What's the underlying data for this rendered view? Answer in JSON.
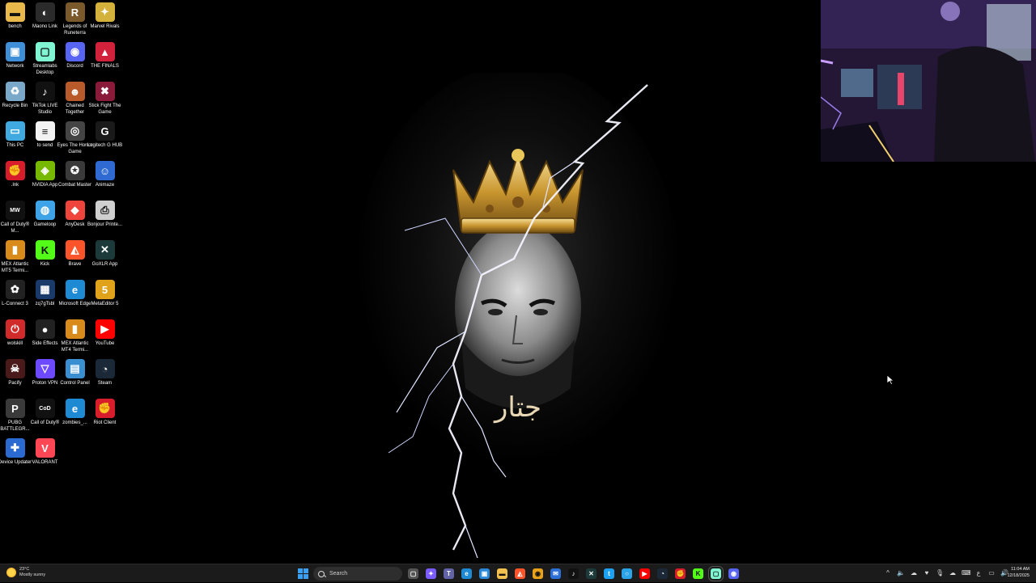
{
  "desktop_icons": [
    {
      "label": "bench",
      "color": "#e8b84a",
      "glyph": "▬"
    },
    {
      "label": "Maono Link",
      "color": "#2b2b2b",
      "glyph": "◐"
    },
    {
      "label": "Legends of Runeterra",
      "color": "#7a5a2a",
      "glyph": "R"
    },
    {
      "label": "Marvel Rivals",
      "color": "#d4b13a",
      "glyph": "✦"
    },
    {
      "label": "Network",
      "color": "#3f8fd8",
      "glyph": "▣"
    },
    {
      "label": "Streamlabs Desktop",
      "color": "#80f5d2",
      "glyph": "▢"
    },
    {
      "label": "Discord",
      "color": "#5865f2",
      "glyph": "◉"
    },
    {
      "label": "THE FINALS",
      "color": "#d2213b",
      "glyph": "▲"
    },
    {
      "label": "Recycle Bin",
      "color": "#7aa8c8",
      "glyph": "♻"
    },
    {
      "label": "TikTok LIVE Studio",
      "color": "#111111",
      "glyph": "♪"
    },
    {
      "label": "Chained Together",
      "color": "#b85a2a",
      "glyph": "☻"
    },
    {
      "label": "Stick Fight The Game",
      "color": "#8a1a3a",
      "glyph": "✖"
    },
    {
      "label": "This PC",
      "color": "#3fa9e0",
      "glyph": "▭"
    },
    {
      "label": "to send",
      "color": "#f2f2f2",
      "glyph": "≡"
    },
    {
      "label": "Eyes The Horror Game",
      "color": "#444444",
      "glyph": "◎"
    },
    {
      "label": "Logitech G HUB",
      "color": "#1a1a1a",
      "glyph": "G"
    },
    {
      "label": ".lnk",
      "color": "#d71d2b",
      "glyph": "✊"
    },
    {
      "label": "NVIDIA App",
      "color": "#76b900",
      "glyph": "◈"
    },
    {
      "label": "Combat Master",
      "color": "#3a3a3a",
      "glyph": "✪"
    },
    {
      "label": "Animaze",
      "color": "#2e6ad1",
      "glyph": "☺"
    },
    {
      "label": "Call of Duty® M...",
      "color": "#111111",
      "glyph": "MW"
    },
    {
      "label": "Gameloop",
      "color": "#3fa3e8",
      "glyph": "◍"
    },
    {
      "label": "AnyDesk",
      "color": "#ef443b",
      "glyph": "◆"
    },
    {
      "label": "Bonjour Printe...",
      "color": "#cfcfcf",
      "glyph": "⎙"
    },
    {
      "label": "MEX Atlantic MT5 Termi...",
      "color": "#d88a1a",
      "glyph": "▮"
    },
    {
      "label": "Kick",
      "color": "#53fc18",
      "glyph": "K"
    },
    {
      "label": "Brave",
      "color": "#fb542b",
      "glyph": "◭"
    },
    {
      "label": "GoXLR App",
      "color": "#1c3a3a",
      "glyph": "✕"
    },
    {
      "label": "L-Connect 3",
      "color": "#222222",
      "glyph": "✿"
    },
    {
      "label": "zq7gTsbl",
      "color": "#1a3a6a",
      "glyph": "▦"
    },
    {
      "label": "Microsoft Edge",
      "color": "#1f8ad4",
      "glyph": "e"
    },
    {
      "label": "MetaEditor 5",
      "color": "#e0a21a",
      "glyph": "5"
    },
    {
      "label": "wolskill",
      "color": "#d12a2a",
      "glyph": "⏻"
    },
    {
      "label": "Side Effects",
      "color": "#222222",
      "glyph": "●"
    },
    {
      "label": "MEX Atlantic MT4 Termi...",
      "color": "#d88a1a",
      "glyph": "▮"
    },
    {
      "label": "YouTube",
      "color": "#ff0000",
      "glyph": "▶"
    },
    {
      "label": "Pacify",
      "color": "#4a1a1a",
      "glyph": "☠"
    },
    {
      "label": "Proton VPN",
      "color": "#6d4aff",
      "glyph": "▽"
    },
    {
      "label": "Control Panel",
      "color": "#3a8fd0",
      "glyph": "▤"
    },
    {
      "label": "Steam",
      "color": "#1b2838",
      "glyph": "◔"
    },
    {
      "label": "PUBG BATTLEGR...",
      "color": "#3a3a3a",
      "glyph": "P"
    },
    {
      "label": "Call of Duty®",
      "color": "#111111",
      "glyph": "CoD"
    },
    {
      "label": "zombies_...",
      "color": "#1f8ad4",
      "glyph": "e"
    },
    {
      "label": "Riot Client",
      "color": "#d71d2b",
      "glyph": "✊"
    },
    {
      "label": "Device Updater",
      "color": "#2a6ad1",
      "glyph": "✚"
    },
    {
      "label": "VALORANT",
      "color": "#ff4655",
      "glyph": "V"
    }
  ],
  "wallpaper": {
    "caption": "جتار"
  },
  "taskbar": {
    "weather_temp": "23°C",
    "weather_desc": "Mostly sunny",
    "search_label": "Search",
    "pinned": [
      {
        "name": "task-view-icon",
        "color": "#555555",
        "glyph": "▢"
      },
      {
        "name": "copilot-icon",
        "color": "#7b5cff",
        "glyph": "✦"
      },
      {
        "name": "teams-icon",
        "color": "#6264a7",
        "glyph": "T"
      },
      {
        "name": "edge-icon",
        "color": "#1f8ad4",
        "glyph": "e"
      },
      {
        "name": "store-icon",
        "color": "#2b88d8",
        "glyph": "▣"
      },
      {
        "name": "file-explorer-icon",
        "color": "#f2c14e",
        "glyph": "▬"
      },
      {
        "name": "brave-icon",
        "color": "#fb542b",
        "glyph": "◭"
      },
      {
        "name": "chrome-icon",
        "color": "#e8a21a",
        "glyph": "◉"
      },
      {
        "name": "mail-icon",
        "color": "#2b6fd6",
        "glyph": "✉"
      },
      {
        "name": "tiktok-icon",
        "color": "#111111",
        "glyph": "♪"
      },
      {
        "name": "goxlr-icon",
        "color": "#1c3a3a",
        "glyph": "✕"
      },
      {
        "name": "twitter-icon",
        "color": "#1da1f2",
        "glyph": "t"
      },
      {
        "name": "cortana-icon",
        "color": "#2aa3e8",
        "glyph": "○"
      },
      {
        "name": "youtube-icon",
        "color": "#ff0000",
        "glyph": "▶"
      },
      {
        "name": "steam-icon",
        "color": "#1b2838",
        "glyph": "◔"
      },
      {
        "name": "riot-icon",
        "color": "#d71d2b",
        "glyph": "✊"
      },
      {
        "name": "kick-icon",
        "color": "#53fc18",
        "glyph": "K"
      },
      {
        "name": "streamlabs-icon",
        "color": "#80f5d2",
        "glyph": "▢"
      },
      {
        "name": "discord-icon",
        "color": "#5865f2",
        "glyph": "◉"
      }
    ],
    "tray_glyphs": [
      "^",
      "🔈",
      "☁",
      "♥",
      "🎙",
      "☁",
      "⌨",
      "ع",
      "▭",
      "🔊"
    ],
    "clock_time": "11:04 AM",
    "clock_date": "12/18/2025"
  }
}
